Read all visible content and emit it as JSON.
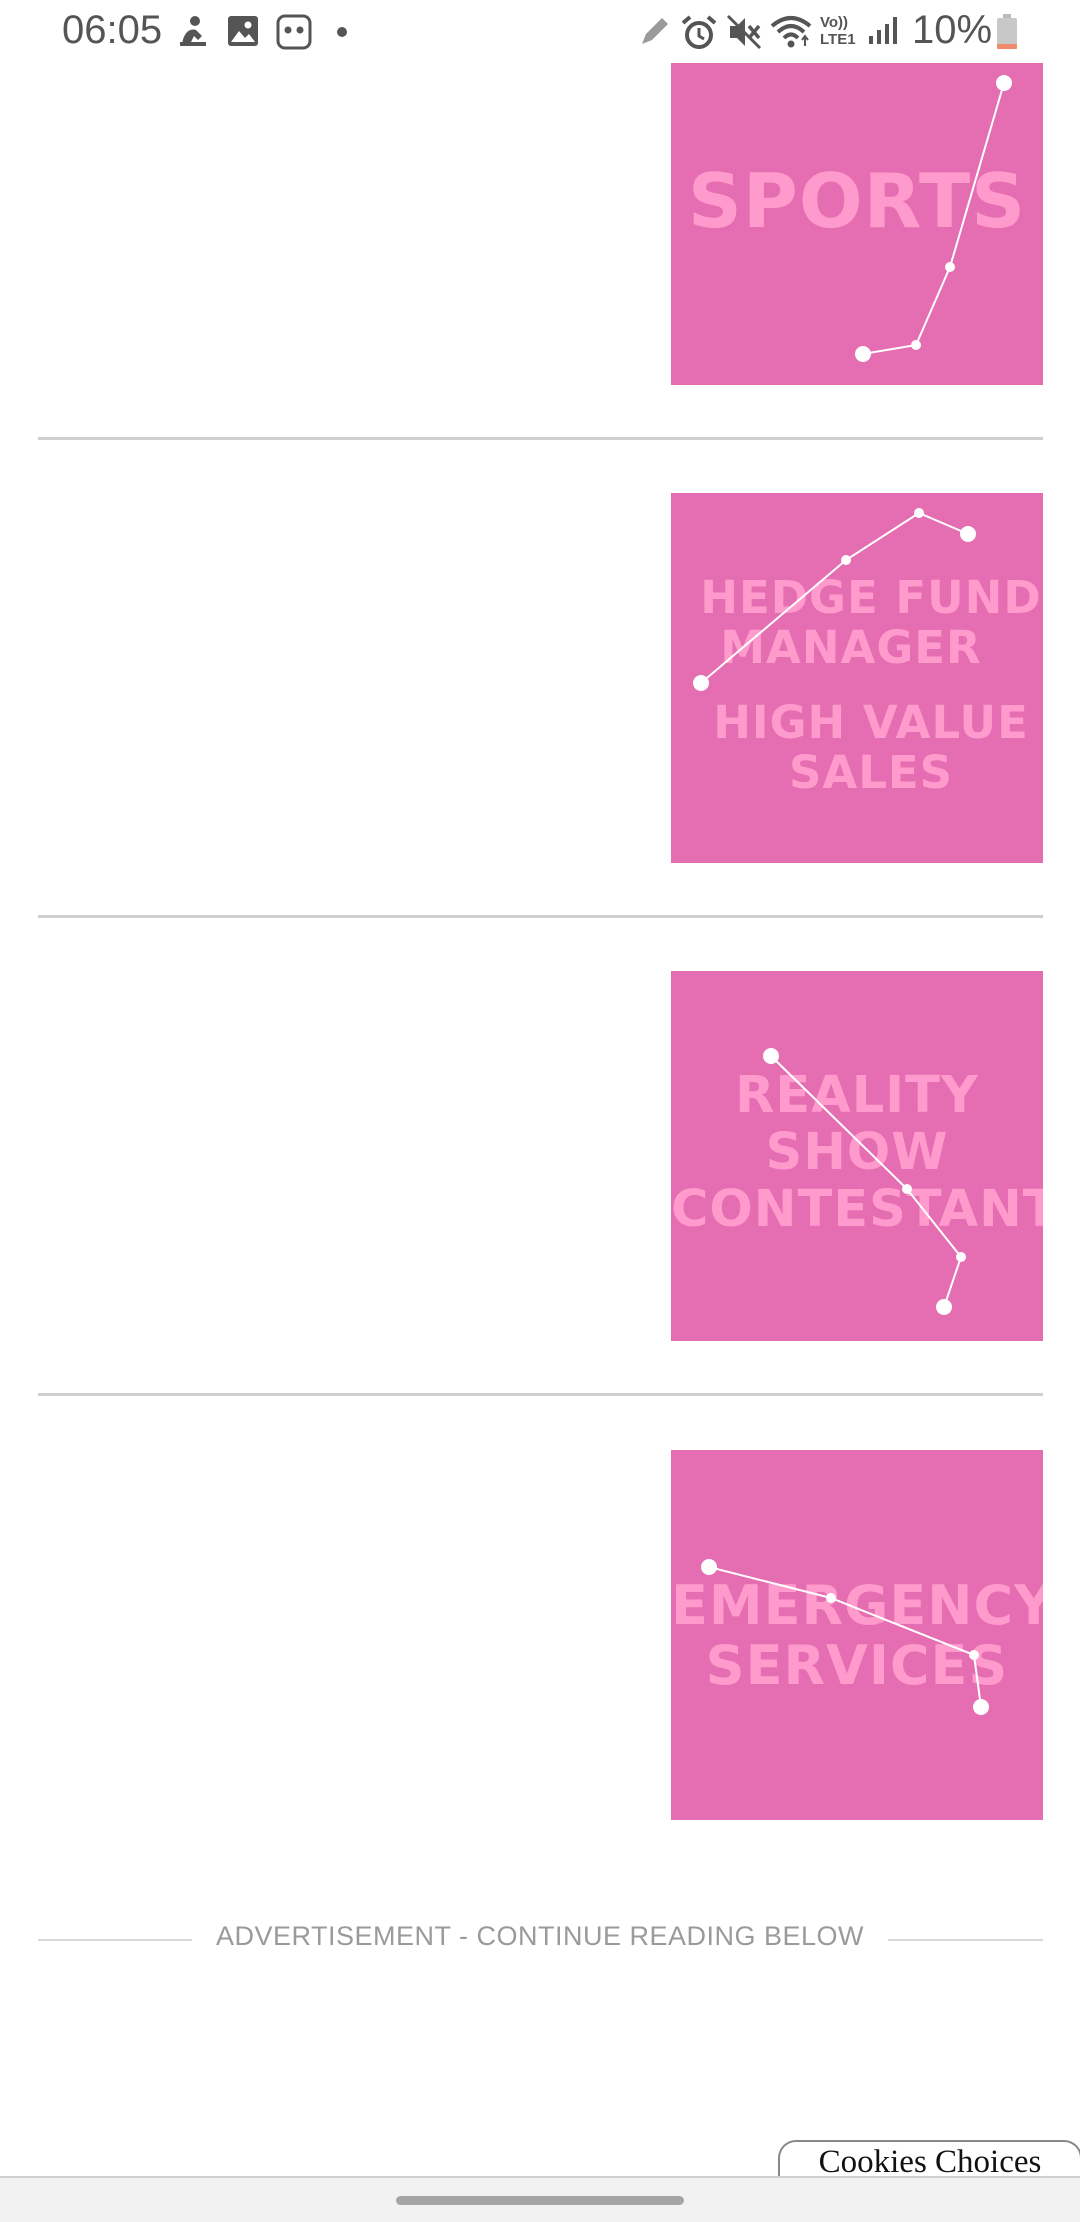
{
  "status_bar": {
    "time": "06:05",
    "left_icons": [
      "person-notification-icon",
      "gallery-icon",
      "app-notification-icon",
      "more-dot-icon"
    ],
    "right_icons": [
      "edit-icon",
      "alarm-icon",
      "mute-icon",
      "wifi-icon",
      "volte-icon",
      "signal-icon",
      "battery-icon"
    ],
    "volte_label": "Vo)) LTE1",
    "battery_percent": "10%",
    "battery_level": 0.1
  },
  "cards": [
    {
      "title_lines": [
        "SPORTS"
      ],
      "color": "#e56db1"
    },
    {
      "title_lines": [
        "HEDGE FUND",
        "MANAGER",
        "HIGH VALUE",
        "SALES"
      ],
      "color": "#e56db1"
    },
    {
      "title_lines": [
        "REALITY",
        "SHOW",
        "CONTESTANT"
      ],
      "color": "#e56db1"
    },
    {
      "title_lines": [
        "EMERGENCY",
        "SERVICES"
      ],
      "color": "#e56db1"
    }
  ],
  "ad_label": "ADVERTISEMENT - CONTINUE READING BELOW",
  "cookies_button": "Cookies Choices",
  "colors": {
    "card_bg": "#e56db1",
    "card_text": "#ff9bcc",
    "constellation": "#ffffff"
  }
}
